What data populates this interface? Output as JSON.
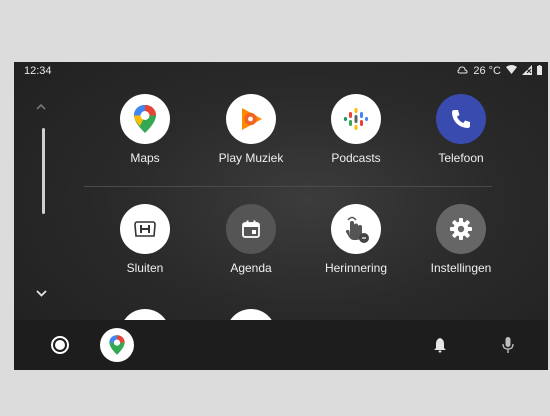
{
  "status": {
    "time": "12:34",
    "temperature": "26 °C"
  },
  "apps": [
    {
      "name": "maps",
      "label": "Maps"
    },
    {
      "name": "play-muziek",
      "label": "Play Muziek"
    },
    {
      "name": "podcasts",
      "label": "Podcasts"
    },
    {
      "name": "telefoon",
      "label": "Telefoon"
    },
    {
      "name": "sluiten",
      "label": "Sluiten"
    },
    {
      "name": "agenda",
      "label": "Agenda"
    },
    {
      "name": "herinnering",
      "label": "Herinnering"
    },
    {
      "name": "instellingen",
      "label": "Instellingen"
    }
  ],
  "colors": {
    "background": "#dcdcdc",
    "screen": "#2a2a2a",
    "dock": "#1d1d1d",
    "phone": "#3a4bb0",
    "agenda": "#555555",
    "settings": "#666666",
    "white": "#ffffff"
  }
}
